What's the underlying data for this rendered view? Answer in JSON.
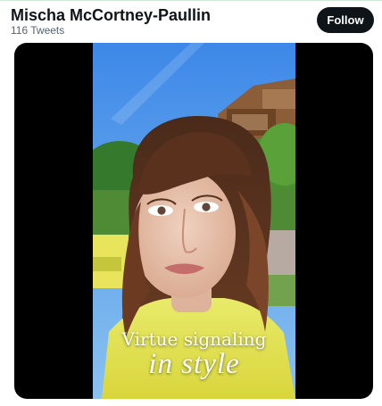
{
  "profile": {
    "name": "Mischa McCortney-Paullin",
    "tweet_count": "116 Tweets"
  },
  "actions": {
    "follow_label": "Follow"
  },
  "media": {
    "caption_line_1": "Virtue signaling",
    "caption_line_2": "in style"
  },
  "colors": {
    "follow_button_bg": "#0f1419",
    "name_text": "#0f1419",
    "subtext": "#536471",
    "media_frame_bg": "#000000"
  }
}
